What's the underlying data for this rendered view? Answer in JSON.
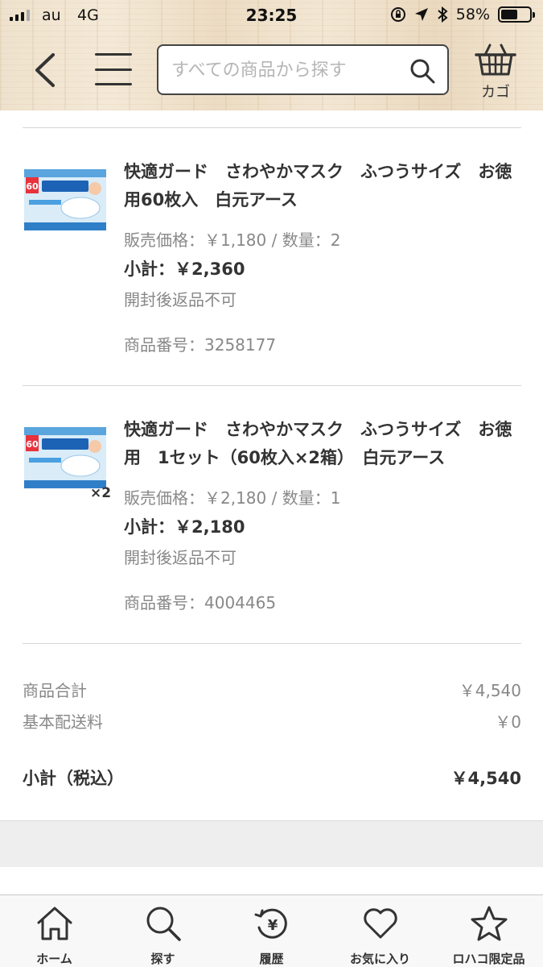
{
  "status_bar": {
    "carrier": "au",
    "network": "4G",
    "time": "23:25",
    "battery": "58%",
    "battery_level": 0.58
  },
  "header": {
    "search_placeholder": "すべての商品から探す",
    "cart_label": "カゴ"
  },
  "items": [
    {
      "name": "快適ガード　さわやかマスク　ふつうサイズ　お徳用60枚入　白元アース",
      "price_line": "販売価格：￥1,180 /  数量：2",
      "subtotal": "小計：￥2,360",
      "note": "開封後返品不可",
      "product_no": "商品番号：3258177",
      "qty_mark": ""
    },
    {
      "name": "快適ガード　さわやかマスク　ふつうサイズ　お徳用　1セット（60枚入×2箱）　白元アース",
      "price_line": "販売価格：￥2,180 /  数量：1",
      "subtotal": "小計：￥2,180",
      "note": "開封後返品不可",
      "product_no": "商品番号：4004465",
      "qty_mark": "×2"
    }
  ],
  "summary": {
    "goods_total_label": "商品合計",
    "goods_total_value": "￥4,540",
    "shipping_label": "基本配送料",
    "shipping_value": "￥0",
    "subtotal_label": "小計（税込）",
    "subtotal_value": "￥4,540"
  },
  "tabs": [
    {
      "label": "ホーム",
      "icon": "home-icon"
    },
    {
      "label": "探す",
      "icon": "search-icon"
    },
    {
      "label": "履歴",
      "icon": "history-yen-icon"
    },
    {
      "label": "お気に入り",
      "icon": "heart-icon"
    },
    {
      "label": "ロハコ限定品",
      "icon": "star-icon"
    }
  ]
}
